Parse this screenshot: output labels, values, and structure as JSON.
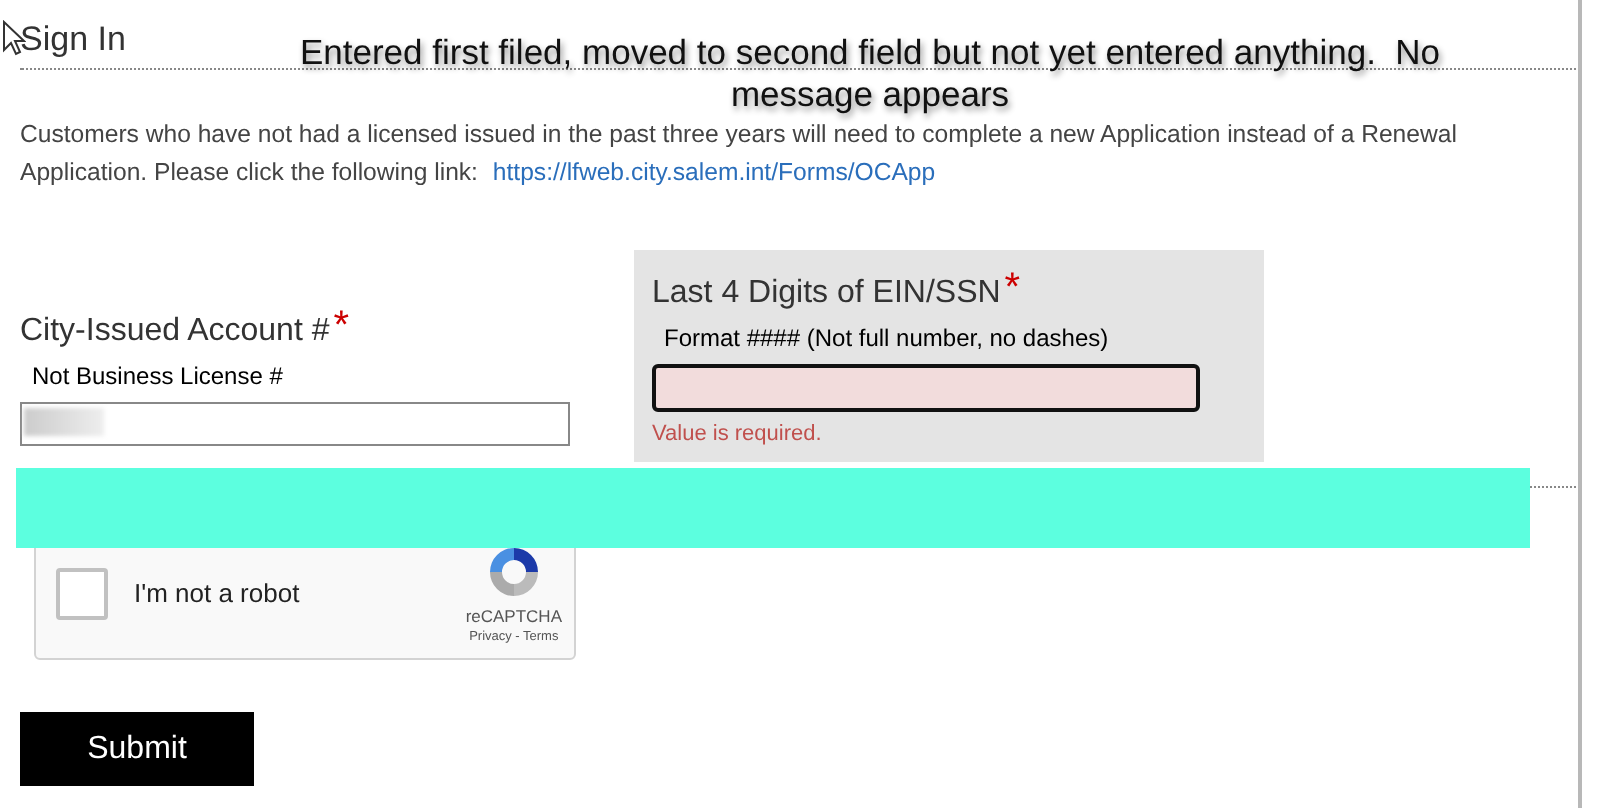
{
  "annotation": {
    "text": "Entered first filed, moved to second field but not yet entered anything.  No message appears"
  },
  "title": "Sign In",
  "notice": {
    "text": "Customers who have not had a licensed issued in the past three years will need to complete a new Application instead of a Renewal Application. Please click the following link:",
    "link": "https://lfweb.city.salem.int/Forms/OCApp"
  },
  "fields": [
    {
      "label": "City-Issued Account #",
      "required_mark": "*",
      "hint": "Not Business License #",
      "highlighted": false,
      "invalid": false,
      "redacted": true
    },
    {
      "label": "Last 4 Digits of EIN/SSN",
      "required_mark": "*",
      "hint": "Format #### (Not full number, no dashes)",
      "highlighted": true,
      "invalid": true,
      "error": "Value is required."
    }
  ],
  "captcha": {
    "label": "I'm not a robot",
    "checked": false,
    "brand": "reCAPTCHA",
    "links": "Privacy - Terms"
  },
  "submit": "Submit"
}
